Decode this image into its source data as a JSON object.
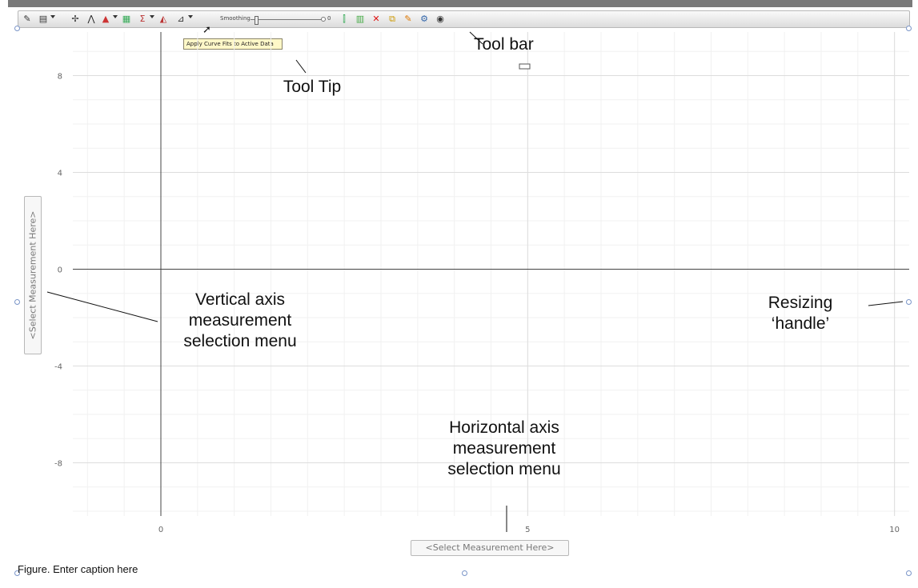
{
  "toolbar": {
    "smoothing_label": "Smoothing",
    "smoothing_value": "0",
    "icons": [
      "edit-icon",
      "chart-type-icon",
      "crosshair-icon",
      "curve-fit-icon",
      "color-icon",
      "grid-icon",
      "sum-icon",
      "mountain-icon",
      "curve-fit-apply-icon",
      "data-column-icon",
      "table-icon",
      "delete-icon",
      "copy-icon",
      "pin-icon",
      "gear-icon",
      "eye-icon"
    ]
  },
  "tooltip": {
    "text": "Apply Curve Fits to Active Data"
  },
  "annotations": {
    "tool_bar": "Tool bar",
    "tool_tip": "Tool Tip",
    "vertical_axis_menu": [
      "Vertical axis",
      "measurement",
      "selection menu"
    ],
    "horizontal_axis_menu": [
      "Horizontal axis",
      "measurement",
      "selection menu"
    ],
    "resizing_handle": [
      "Resizing",
      "‘handle’"
    ]
  },
  "axis_menus": {
    "vertical": "<Select Measurement Here>",
    "horizontal": "<Select Measurement Here>"
  },
  "caption": "Figure. Enter caption here",
  "chart_data": {
    "type": "scatter",
    "xlim": [
      -1.2,
      10.2
    ],
    "ylim": [
      -10.2,
      9.8
    ],
    "x_ticks": [
      0,
      5,
      10
    ],
    "y_ticks": [
      8,
      4,
      0,
      -4,
      -8
    ],
    "grid": true,
    "series": []
  }
}
